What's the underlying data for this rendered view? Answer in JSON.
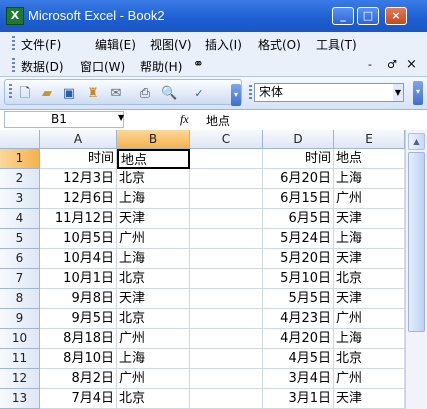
{
  "window": {
    "title": "Microsoft Excel - Book2",
    "app_icon": "excel-icon",
    "buttons": [
      "_",
      "□",
      "×"
    ]
  },
  "menu": {
    "row1": [
      "文件(F)",
      "编辑(E)",
      "视图(V)",
      "插入(I)",
      "格式(O)",
      "工具(T)"
    ],
    "row2": [
      "数据(D)",
      "窗口(W)",
      "帮助(H)"
    ],
    "doc_controls": [
      "-",
      "♂",
      "×"
    ]
  },
  "toolbar": {
    "font_name": "宋体",
    "icons": [
      "new-icon",
      "open-icon",
      "save-icon",
      "permission-icon",
      "email-icon",
      "print-icon",
      "print-preview-icon",
      "spelling-icon"
    ]
  },
  "formula_bar": {
    "name_box": "B1",
    "fx_label": "fx",
    "value": "地点"
  },
  "sheet": {
    "columns": [
      "A",
      "B",
      "C",
      "D",
      "E"
    ],
    "selected_col": "B",
    "selected_row": "1",
    "rows": [
      {
        "n": "1",
        "a": "时间",
        "b": "地点",
        "c": "",
        "d": "时间",
        "e": "地点"
      },
      {
        "n": "2",
        "a": "12月3日",
        "b": "北京",
        "c": "",
        "d": "6月20日",
        "e": "上海"
      },
      {
        "n": "3",
        "a": "12月6日",
        "b": "上海",
        "c": "",
        "d": "6月15日",
        "e": "广州"
      },
      {
        "n": "4",
        "a": "11月12日",
        "b": "天津",
        "c": "",
        "d": "6月5日",
        "e": "天津"
      },
      {
        "n": "5",
        "a": "10月5日",
        "b": "广州",
        "c": "",
        "d": "5月24日",
        "e": "上海"
      },
      {
        "n": "6",
        "a": "10月4日",
        "b": "上海",
        "c": "",
        "d": "5月20日",
        "e": "天津"
      },
      {
        "n": "7",
        "a": "10月1日",
        "b": "北京",
        "c": "",
        "d": "5月10日",
        "e": "北京"
      },
      {
        "n": "8",
        "a": "9月8日",
        "b": "天津",
        "c": "",
        "d": "5月5日",
        "e": "天津"
      },
      {
        "n": "9",
        "a": "9月5日",
        "b": "北京",
        "c": "",
        "d": "4月23日",
        "e": "广州"
      },
      {
        "n": "10",
        "a": "8月18日",
        "b": "广州",
        "c": "",
        "d": "4月20日",
        "e": "上海"
      },
      {
        "n": "11",
        "a": "8月10日",
        "b": "上海",
        "c": "",
        "d": "4月5日",
        "e": "北京"
      },
      {
        "n": "12",
        "a": "8月2日",
        "b": "广州",
        "c": "",
        "d": "3月4日",
        "e": "广州"
      },
      {
        "n": "13",
        "a": "7月4日",
        "b": "北京",
        "c": "",
        "d": "3月1日",
        "e": "天津"
      },
      {
        "n": "14",
        "a": "7月1日",
        "b": "天津",
        "c": "",
        "d": "2月15日",
        "e": "北京"
      }
    ]
  }
}
